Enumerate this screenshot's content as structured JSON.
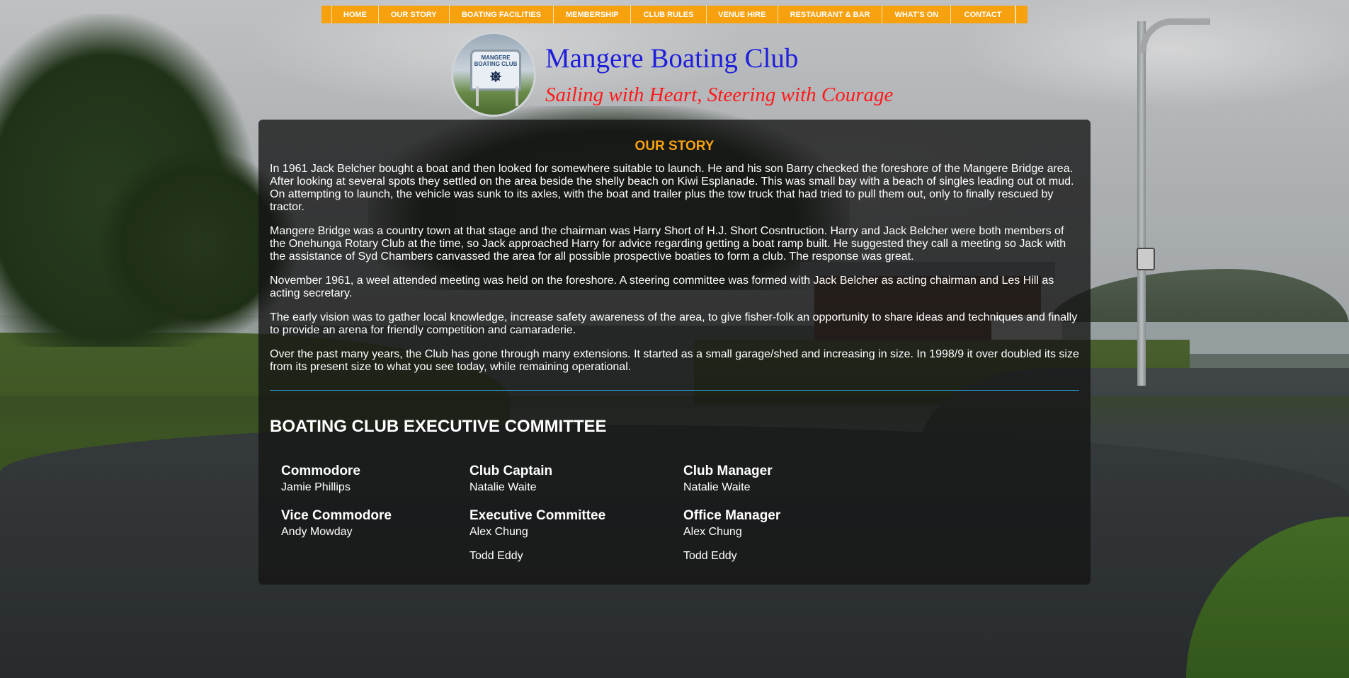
{
  "nav": {
    "items": [
      "HOME",
      "OUR STORY",
      "BOATING FACILITIES",
      "MEMBERSHIP",
      "CLUB RULES",
      "VENUE HIRE",
      "RESTAURANT & BAR",
      "WHAT'S ON",
      "CONTACT"
    ]
  },
  "header": {
    "logo_text": "MANGERE BOATING CLUB",
    "title": "Mangere Boating Club",
    "tagline": "Sailing with Heart, Steering with Courage"
  },
  "story": {
    "heading": "OUR STORY",
    "paragraphs": [
      "In 1961 Jack Belcher bought a boat and then looked for somewhere suitable to launch. He and his son Barry checked the foreshore of the Mangere Bridge area. After looking at several spots they settled on the area beside the shelly beach on Kiwi Esplanade. This was small bay with a beach of singles leading out ot mud. On attempting to launch, the vehicle was sunk to its axles, with the boat and trailer plus the tow truck that had tried to pull them out, only to finally rescued by tractor.",
      "Mangere Bridge was a country town at that stage and the chairman was Harry Short of H.J. Short Cosntruction. Harry and Jack Belcher were both members of the Onehunga Rotary Club at the time, so Jack approached Harry for advice regarding getting a boat ramp built. He suggested they call a meeting so Jack with the assistance of Syd Chambers canvassed the area for all possible prospective boaties to form a club. The response was great.",
      "November 1961, a weel attended meeting was held on the foreshore. A steering committee was formed with Jack Belcher as acting chairman and Les Hill as acting secretary.",
      "The early vision was to gather local knowledge, increase safety awareness of the area, to give fisher-folk an opportunity to share ideas and techniques and finally to provide an arena for friendly competition and camaraderie.",
      "Over the past many years, the Club has gone through many extensions. It started as a small garage/shed and increasing in size. In 1998/9 it over doubled its size from its present size to what you see today, while remaining operational."
    ]
  },
  "committee": {
    "heading": "BOATING CLUB EXECUTIVE COMMITTEE",
    "roles": [
      {
        "title": "Commodore",
        "names": [
          "Jamie Phillips"
        ]
      },
      {
        "title": "Club Captain",
        "names": [
          "Natalie Waite"
        ]
      },
      {
        "title": "Club Manager",
        "names": [
          "Natalie Waite"
        ]
      },
      {
        "title": "Vice Commodore",
        "names": [
          "Andy Mowday"
        ]
      },
      {
        "title": "Executive Committee",
        "names": [
          "Alex Chung",
          "Todd Eddy"
        ]
      },
      {
        "title": "Office Manager",
        "names": [
          "Alex Chung",
          "Todd Eddy"
        ]
      }
    ]
  },
  "colors": {
    "nav_bg": "#f7a10f",
    "title": "#1e1edc",
    "tagline": "#ff1a1a",
    "story_heading": "#f7a10f",
    "divider": "#2b9ad0"
  },
  "icons": [
    "ship-wheel-icon"
  ]
}
